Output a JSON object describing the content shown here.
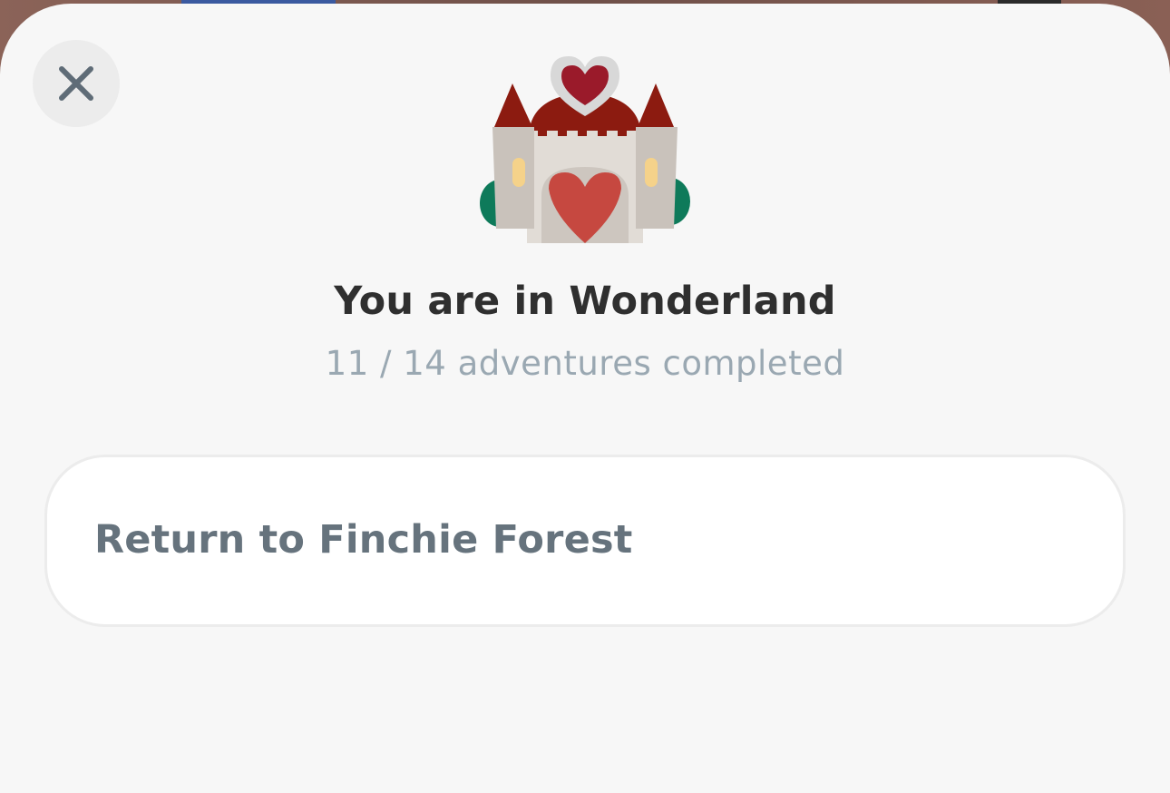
{
  "dialog": {
    "title": "You are in Wonderland",
    "progress_text": "11 / 14 adventures completed",
    "progress": {
      "completed": 11,
      "total": 14
    }
  },
  "close_button": {
    "icon": "close-icon"
  },
  "illustration": {
    "icon": "castle-heart-icon"
  },
  "options": [
    {
      "label": "Return to Finchie Forest"
    }
  ],
  "colors": {
    "sheet_background": "#f7f7f7",
    "title": "#2f2f2f",
    "subtitle": "#9aa8b2",
    "option_text": "#66737d"
  }
}
